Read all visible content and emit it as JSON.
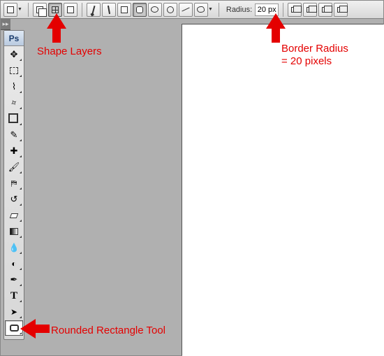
{
  "options": {
    "radius_label": "Radius:",
    "radius_value": "20 px"
  },
  "toolbox": {
    "app_label": "Ps",
    "tools": {
      "move": "Move Tool",
      "marquee": "Rectangular Marquee",
      "lasso": "Lasso Tool",
      "wand": "Quick Selection",
      "crop": "Crop Tool",
      "eyedropper": "Eyedropper",
      "heal": "Spot Healing Brush",
      "brush": "Brush Tool",
      "stamp": "Clone Stamp",
      "history": "History Brush",
      "eraser": "Eraser",
      "gradient": "Gradient",
      "blur": "Blur",
      "dodge": "Dodge",
      "pen": "Pen Tool",
      "type": "Type Tool",
      "path": "Path Selection",
      "shape": "Rounded Rectangle Tool"
    }
  },
  "annotations": {
    "shape_layers": "Shape Layers",
    "border_radius_l1": "Border Radius",
    "border_radius_l2": "= 20 pixels",
    "rounded_rect": "Rounded Rectangle Tool"
  }
}
